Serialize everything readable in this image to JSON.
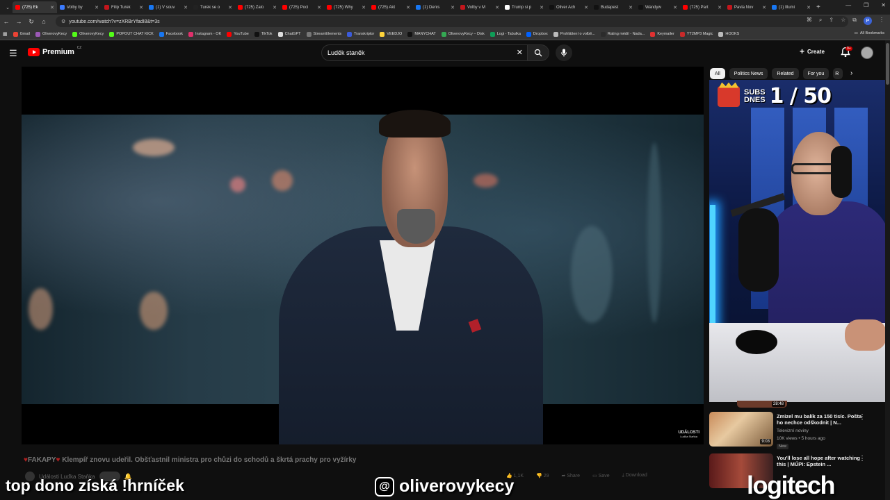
{
  "browser": {
    "tabs": [
      {
        "label": "(725) Ek",
        "color": "#ff0000"
      },
      {
        "label": "Volby by",
        "color": "#3b7bff"
      },
      {
        "label": "Filip Turek",
        "color": "#c4161c"
      },
      {
        "label": "(1) V souv",
        "color": "#1877f2"
      },
      {
        "label": "Turek se o",
        "color": "#222222"
      },
      {
        "label": "(725) Zalo",
        "color": "#ff0000"
      },
      {
        "label": "(725) Poci",
        "color": "#ff0000"
      },
      {
        "label": "(725) Why",
        "color": "#ff0000"
      },
      {
        "label": "(725) Akt",
        "color": "#ff0000"
      },
      {
        "label": "(1) Denis",
        "color": "#1877f2"
      },
      {
        "label": "Volby v M",
        "color": "#c4161c"
      },
      {
        "label": "Trump si p",
        "color": "#ffffff"
      },
      {
        "label": "Oliver Ach",
        "color": "#111111"
      },
      {
        "label": "Budapest",
        "color": "#111111"
      },
      {
        "label": "Wandyw",
        "color": "#111111"
      },
      {
        "label": "(725) Part",
        "color": "#ff0000"
      },
      {
        "label": "Pavla Nov",
        "color": "#c4161c"
      },
      {
        "label": "(1) Illumi",
        "color": "#1877f2"
      }
    ],
    "new_tab": "+",
    "url": "youtube.com/watch?v=zXRBrYfadI8&t=3s",
    "profile_initial": "P",
    "bookmarks": [
      {
        "label": "Gmail",
        "color": "#ea4335"
      },
      {
        "label": "OliverovyKecy",
        "color": "#9b59b6"
      },
      {
        "label": "OliverovyKecy",
        "color": "#53fc18"
      },
      {
        "label": "POPOUT CHAT KICK",
        "color": "#53fc18"
      },
      {
        "label": "Facebook",
        "color": "#1877f2"
      },
      {
        "label": "Instagram - OK",
        "color": "#e1306c"
      },
      {
        "label": "YouTube",
        "color": "#ff0000"
      },
      {
        "label": "TikTok",
        "color": "#111111"
      },
      {
        "label": "ChatGPT",
        "color": "#dddddd"
      },
      {
        "label": "StreamElements",
        "color": "#777777"
      },
      {
        "label": "Transkriptor",
        "color": "#3b5bdb"
      },
      {
        "label": "VEEDJO",
        "color": "#ffd43b"
      },
      {
        "label": "MANYCHAT",
        "color": "#111111"
      },
      {
        "label": "OliverovyKecy – Disk",
        "color": "#34a853"
      },
      {
        "label": "Logi - Tabulka",
        "color": "#0f9d58"
      },
      {
        "label": "Dropbox",
        "color": "#0061ff"
      },
      {
        "label": "Prohlášení o volbě...",
        "color": "#bbbbbb"
      },
      {
        "label": "Rating médií - Nada...",
        "color": "#2b2b2b"
      },
      {
        "label": "Keymailer",
        "color": "#e03131"
      },
      {
        "label": "YT2MP3 Magic",
        "color": "#c92a2a"
      },
      {
        "label": "HOOKS",
        "color": "#bbbbbb"
      }
    ],
    "all_bookmarks": "All Bookmarks"
  },
  "yt": {
    "logo_text": "Premium",
    "country": "CZ",
    "search_value": "Luděk staněk",
    "create_label": "Create",
    "notif_badge": "9+",
    "chips": [
      "All",
      "Politics News",
      "Related",
      "For you",
      "R"
    ]
  },
  "player": {
    "watermark_line1": "UDÁLOSTI",
    "watermark_line2": "Luďka Staňka"
  },
  "video": {
    "title_tag": "FAKAPY",
    "title_rest": "Klempíř znovu udeřil. Obšťastnil ministra pro chůzi do schodů a škrtá prachy pro vyžírky",
    "channel": "Události Luďka Staňka",
    "likes": "1,1K",
    "dislikes": "29",
    "share": "Share",
    "save": "Save",
    "download": "Download"
  },
  "webcam": {
    "subs_label": "SUBS\nDNES",
    "subs_count": "1 / 50"
  },
  "recommended": [
    {
      "title": "",
      "duration": "28:48",
      "meta1": "",
      "meta2": "",
      "badge": ""
    },
    {
      "title": "Zmizel mu balík za 150 tisíc. Pošta ho nechce odškodnit | N...",
      "duration": "9:03",
      "meta1": "Televizní noviny",
      "meta2": "10K views • 5 hours ago",
      "badge": "New"
    },
    {
      "title": "You'll lose all hope after watching this | MÚPI: Epstein ...",
      "duration": "",
      "meta1": "",
      "meta2": "",
      "badge": ""
    }
  ],
  "overlay": {
    "left_text": "top dono získá !hrníček",
    "threads_handle": "oliverovykecy",
    "brand": "logitech"
  }
}
